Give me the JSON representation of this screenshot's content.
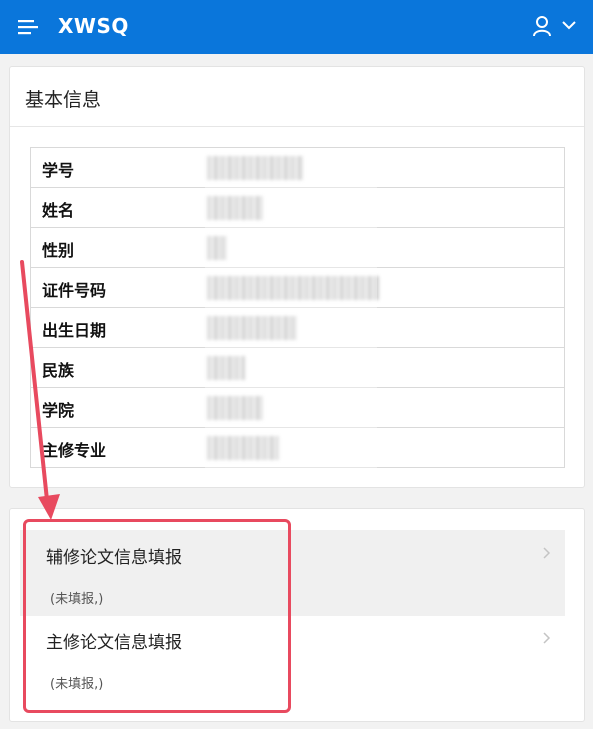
{
  "header": {
    "app_title": "XWSQ",
    "menu_icon": "hamburger-menu-icon",
    "user_icon": "user-icon",
    "dropdown_icon": "chevron-down-icon",
    "bg_color": "#0a76db"
  },
  "basic_info": {
    "title": "基本信息",
    "rows": [
      {
        "label": "学号",
        "value": ""
      },
      {
        "label": "姓名",
        "value": ""
      },
      {
        "label": "性别",
        "value": ""
      },
      {
        "label": "证件号码",
        "value": ""
      },
      {
        "label": "出生日期",
        "value": ""
      },
      {
        "label": "民族",
        "value": ""
      },
      {
        "label": "学院",
        "value": ""
      },
      {
        "label": "主修专业",
        "value": ""
      }
    ]
  },
  "thesis_list": {
    "items": [
      {
        "title": "辅修论文信息填报",
        "status": "(未填报,)"
      },
      {
        "title": "主修论文信息填报",
        "status": "(未填报,)"
      }
    ]
  },
  "annotation": {
    "color": "#e84a5f"
  }
}
